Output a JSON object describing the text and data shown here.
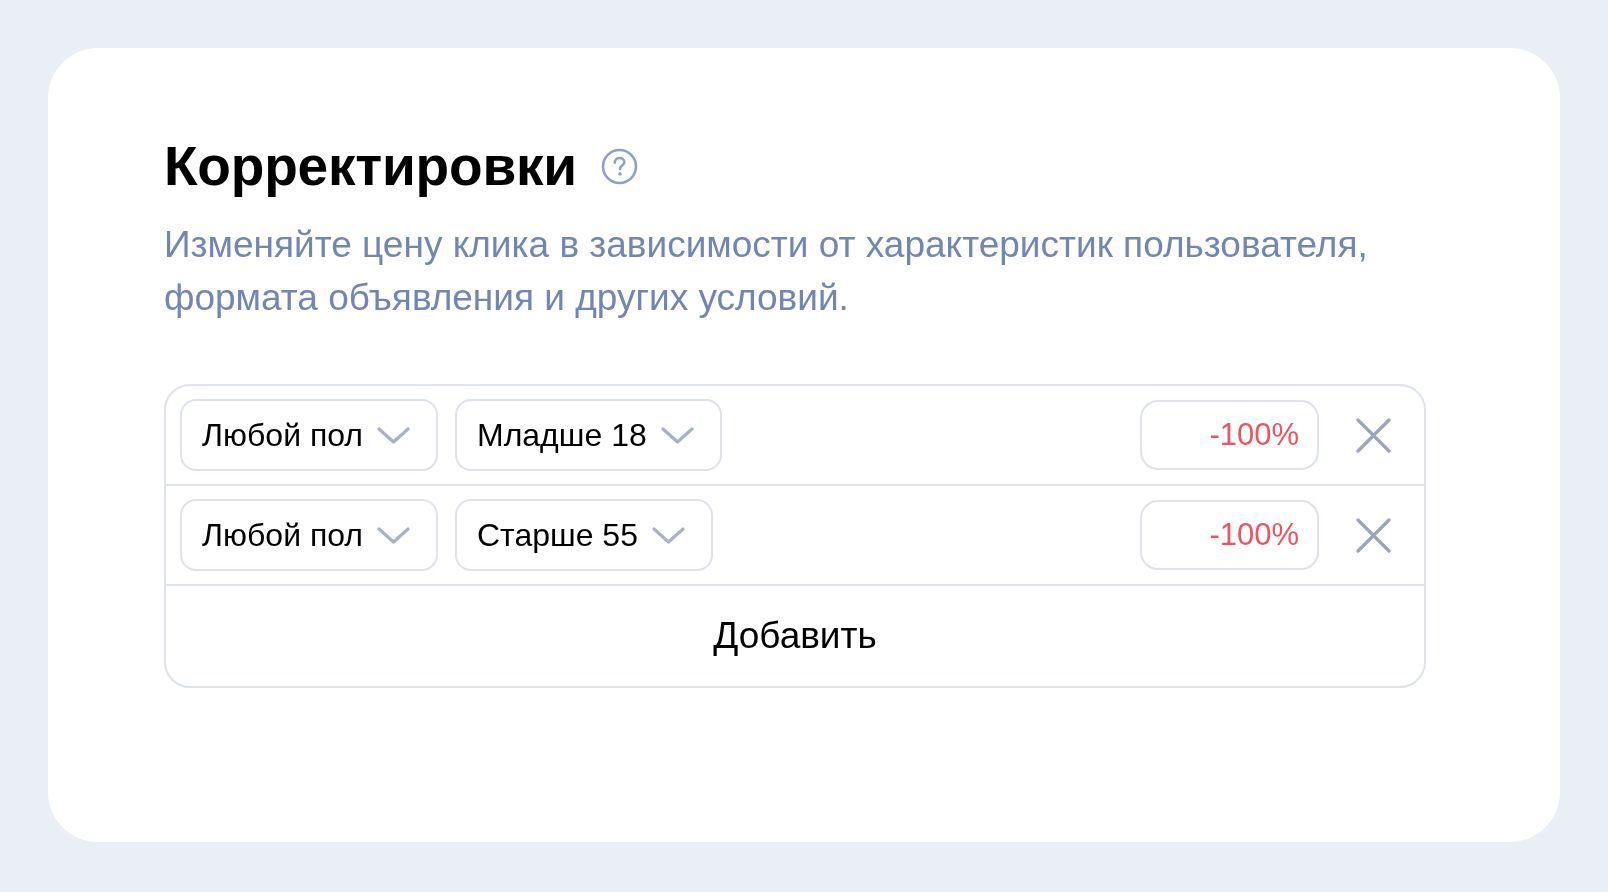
{
  "title": "Корректировки",
  "description": "Изменяйте цену клика в зависимости от характеристик пользователя, формата объявления и других условий.",
  "adjustments": [
    {
      "gender": "Любой пол",
      "age": "Младше 18",
      "value": "-100%"
    },
    {
      "gender": "Любой пол",
      "age": "Старше 55",
      "value": "-100%"
    }
  ],
  "add_button": "Добавить"
}
